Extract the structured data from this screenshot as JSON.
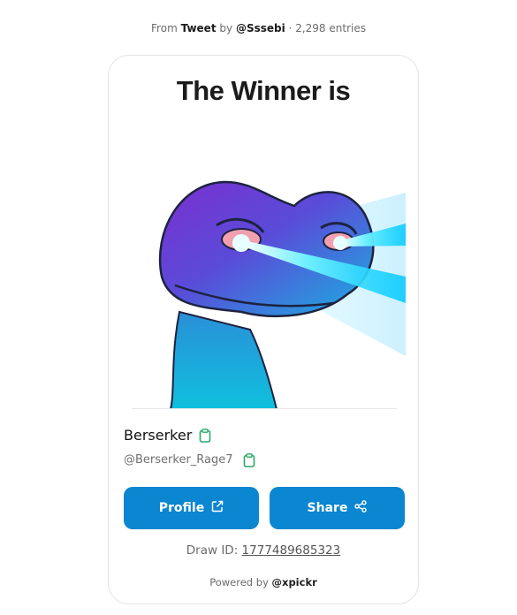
{
  "source": {
    "prefix": "From",
    "platform": "Tweet",
    "by": "by",
    "author": "@Sssebi",
    "separator": "·",
    "entries": "2,298 entries"
  },
  "card": {
    "title": "The Winner is",
    "winner_name": "Berserker",
    "winner_handle": "@Berserker_Rage7",
    "profile_label": "Profile",
    "share_label": "Share",
    "draw_id_label": "Draw ID:",
    "draw_id_value": "1777489685323",
    "powered_prefix": "Powered by",
    "powered_brand": "@xpickr"
  },
  "icons": {
    "copy": "clipboard-icon",
    "external": "external-link-icon",
    "share": "share-nodes-icon"
  },
  "colors": {
    "button_bg": "#0b86d0",
    "copy_icon": "#2aa86a"
  }
}
